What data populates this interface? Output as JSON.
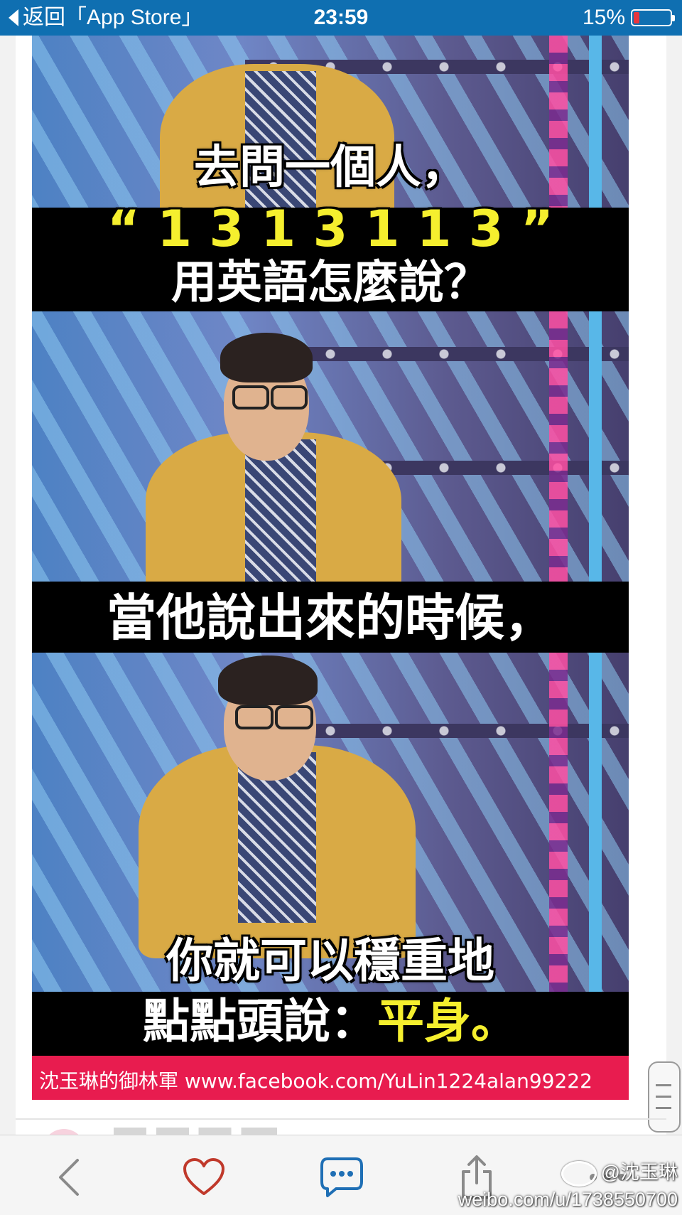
{
  "status_bar": {
    "back_label": "返回「App Store」",
    "time": "23:59",
    "battery_percent": "15%",
    "battery_level": 0.15
  },
  "meme": {
    "caption1_line1": "去問一個人，",
    "caption1_line2": "“ 1 3 1 3 1 1 3 ”",
    "caption1_line3": "用英語怎麼說？",
    "caption2": "當他說出來的時候，",
    "caption3_line1": "你就可以穩重地",
    "caption3_line2_white": "點點頭說：",
    "caption3_line2_yellow": "平身。",
    "footer": "沈玉琳的御林軍 www.facebook.com/YuLin1224alan99222",
    "colors": {
      "caption_yellow": "#f5ef2e",
      "footer_red": "#e81c4f"
    }
  },
  "toolbar": {
    "back_icon": "chevron-left-icon",
    "like_icon": "heart-icon",
    "comment_icon": "comment-icon",
    "share_icon": "share-icon",
    "like_color": "#c0392b",
    "comment_color": "#1f6fb5"
  },
  "watermark": {
    "handle": "@沈玉琳",
    "url": "weibo.com/u/1738550700"
  }
}
